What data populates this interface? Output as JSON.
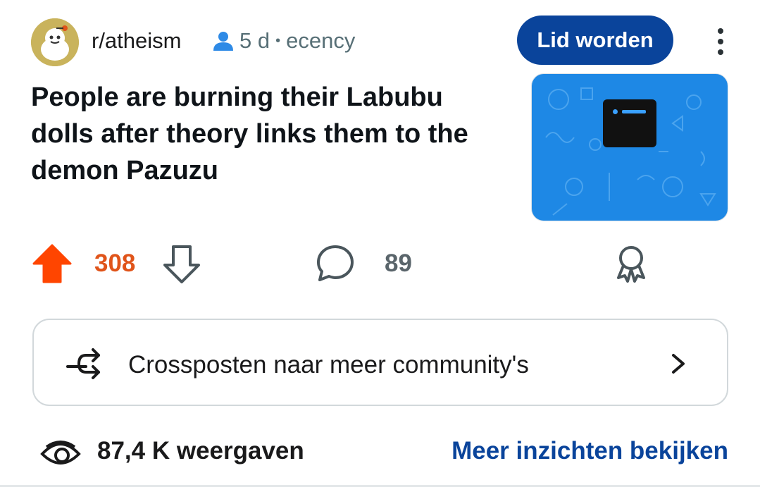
{
  "post": {
    "subreddit": "r/atheism",
    "age": "5 d",
    "separator": "•",
    "author": "ecency",
    "join_label": "Lid worden",
    "title": "People are burning their Labubu dolls after theory links them to the demon Pazuzu",
    "score": "308",
    "comments": "89"
  },
  "crosspost": {
    "label": "Crossposten naar meer community's"
  },
  "footer": {
    "views": "87,4 K weergaven",
    "insights_link": "Meer inzichten bekijken"
  },
  "icons": {
    "avatar": "snoo-avatar",
    "author": "person-icon",
    "more": "more-vertical-icon",
    "thumbnail": "link-preview-icon",
    "upvote": "upvote-icon",
    "downvote": "downvote-icon",
    "comment": "comment-icon",
    "award": "award-icon",
    "crosspost": "crosspost-icon",
    "chevron": "chevron-right-icon",
    "views": "eye-icon"
  },
  "colors": {
    "accent": "#0a449b",
    "upvote": "#ff4500",
    "score": "#e0541a",
    "thumbnail": "#1e88e5"
  }
}
